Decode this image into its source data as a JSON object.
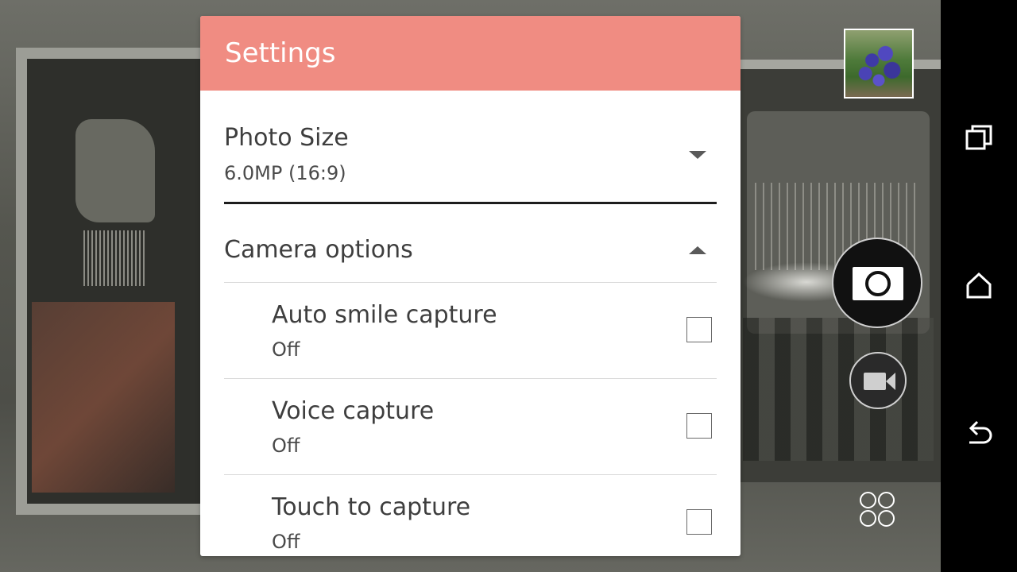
{
  "settings": {
    "title": "Settings",
    "photo_size": {
      "title": "Photo Size",
      "value": "6.0MP (16:9)"
    },
    "camera_options": {
      "title": "Camera options"
    },
    "options": [
      {
        "title": "Auto smile capture",
        "status": "Off",
        "checked": false
      },
      {
        "title": "Voice capture",
        "status": "Off",
        "checked": false
      },
      {
        "title": "Touch to capture",
        "status": "Off",
        "checked": false
      }
    ]
  },
  "colors": {
    "header": "#f08c82",
    "panel": "#ffffff",
    "nav_bar": "#000000"
  },
  "icons": {
    "thumbnail": "last-photo-thumbnail",
    "shutter": "camera-icon",
    "video": "video-camera-icon",
    "modes": "modes-grid-icon",
    "recents": "recents-icon",
    "home": "home-icon",
    "back": "back-icon"
  }
}
